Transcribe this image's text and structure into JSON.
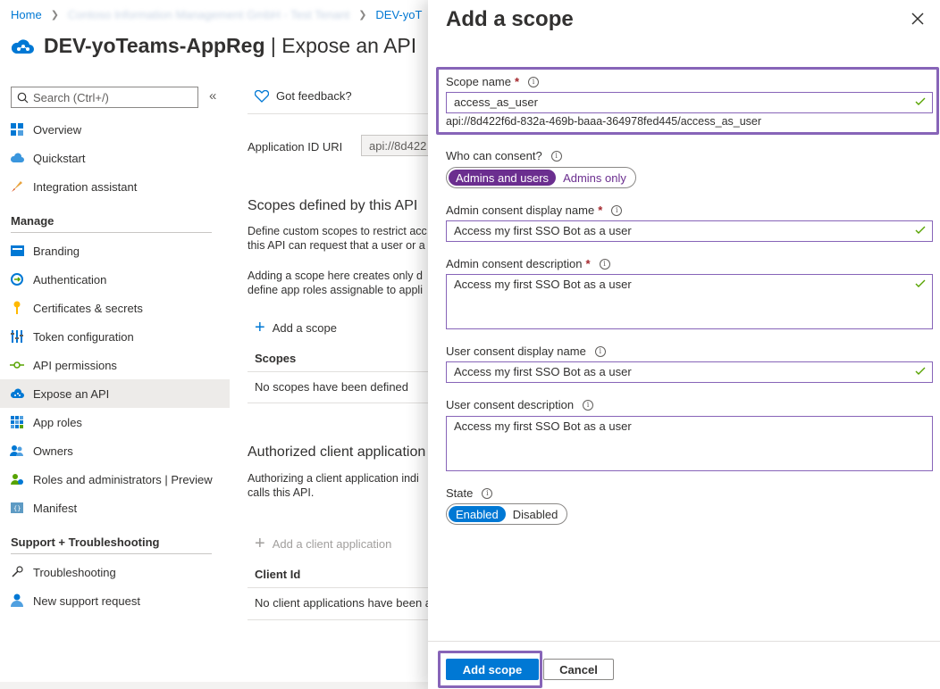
{
  "breadcrumb": {
    "home": "Home",
    "tenant": "Contoso Information Management GmbH - Test Tenant",
    "app": "DEV-yoT"
  },
  "header": {
    "app_name": "DEV-yoTeams-AppReg",
    "section": "| Expose an API"
  },
  "sidebar": {
    "search_placeholder": "Search (Ctrl+/)",
    "collapse": "«",
    "items_top": [
      {
        "label": "Overview",
        "icon": "grid-icon"
      },
      {
        "label": "Quickstart",
        "icon": "cloud-icon"
      },
      {
        "label": "Integration assistant",
        "icon": "rocket-icon"
      }
    ],
    "manage_heading": "Manage",
    "items_manage": [
      {
        "label": "Branding",
        "icon": "branding-icon"
      },
      {
        "label": "Authentication",
        "icon": "authentication-icon"
      },
      {
        "label": "Certificates & secrets",
        "icon": "key-icon"
      },
      {
        "label": "Token configuration",
        "icon": "token-icon"
      },
      {
        "label": "API permissions",
        "icon": "api-permissions-icon"
      },
      {
        "label": "Expose an API",
        "icon": "cloud-api-icon"
      },
      {
        "label": "App roles",
        "icon": "app-roles-icon"
      },
      {
        "label": "Owners",
        "icon": "owners-icon"
      },
      {
        "label": "Roles and administrators | Preview",
        "icon": "roles-icon"
      },
      {
        "label": "Manifest",
        "icon": "manifest-icon"
      }
    ],
    "support_heading": "Support + Troubleshooting",
    "items_support": [
      {
        "label": "Troubleshooting",
        "icon": "wrench-icon"
      },
      {
        "label": "New support request",
        "icon": "person-support-icon"
      }
    ]
  },
  "main": {
    "feedback": "Got feedback?",
    "app_id_label": "Application ID URI",
    "app_id_value": "api://8d422",
    "scopes_heading": "Scopes defined by this API",
    "scopes_desc_1": "Define custom scopes to restrict acc",
    "scopes_desc_2": "this API can request that a user or a",
    "scopes_desc_3": "Adding a scope here creates only d",
    "scopes_desc_4": "define app roles assignable to appli",
    "add_scope_link": "Add a scope",
    "scopes_col": "Scopes",
    "scopes_empty": "No scopes have been defined",
    "auth_heading": "Authorized client application",
    "auth_desc_1": "Authorizing a client application indi",
    "auth_desc_2": "calls this API.",
    "add_client_link": "Add a client application",
    "client_col": "Client Id",
    "client_empty": "No client applications have been a"
  },
  "panel": {
    "title": "Add a scope",
    "scope_name_label": "Scope name",
    "scope_name_value": "access_as_user",
    "scope_uri": "api://8d422f6d-832a-469b-baaa-364978fed445/access_as_user",
    "consent_label": "Who can consent?",
    "consent_options": [
      "Admins and users",
      "Admins only"
    ],
    "admin_display_label": "Admin consent display name",
    "admin_display_value": "Access my first SSO Bot as a user",
    "admin_desc_label": "Admin consent description",
    "admin_desc_value": "Access my first SSO Bot as a user",
    "user_display_label": "User consent display name",
    "user_display_value": "Access my first SSO Bot as a user",
    "user_desc_label": "User consent description",
    "user_desc_value": "Access my first SSO Bot as a user",
    "state_label": "State",
    "state_options": [
      "Enabled",
      "Disabled"
    ],
    "add_button": "Add scope",
    "cancel_button": "Cancel"
  },
  "colors": {
    "accent": "#0078d4",
    "highlight": "#8764b8",
    "consent_selected": "#6b2e8f",
    "valid_check": "#57a300",
    "required": "#a4262c"
  }
}
